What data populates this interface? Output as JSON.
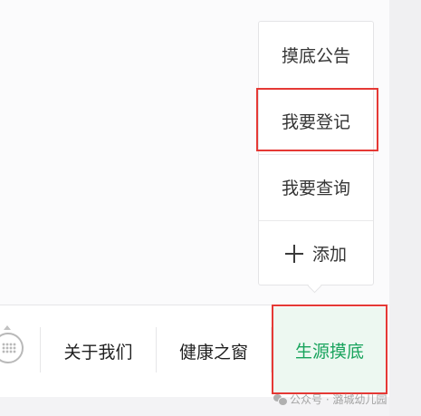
{
  "submenu": {
    "items": [
      {
        "label": "摸底公告"
      },
      {
        "label": "我要登记"
      },
      {
        "label": "我要查询"
      },
      {
        "label": "添加",
        "icon": "plus-icon"
      }
    ]
  },
  "bottom_tabs": [
    {
      "label": "关于我们"
    },
    {
      "label": "健康之窗"
    },
    {
      "label": "生源摸底",
      "active": true
    }
  ],
  "keyboard_toggle": {
    "icon": "keyboard-icon"
  },
  "watermark": {
    "text": "公众号 · 潞城幼儿园",
    "icon": "wechat-icon"
  },
  "colors": {
    "active_tab_text": "#18a35c",
    "active_tab_bg": "#edf8f1",
    "highlight_box": "#e53935",
    "menu_text": "#353535"
  }
}
